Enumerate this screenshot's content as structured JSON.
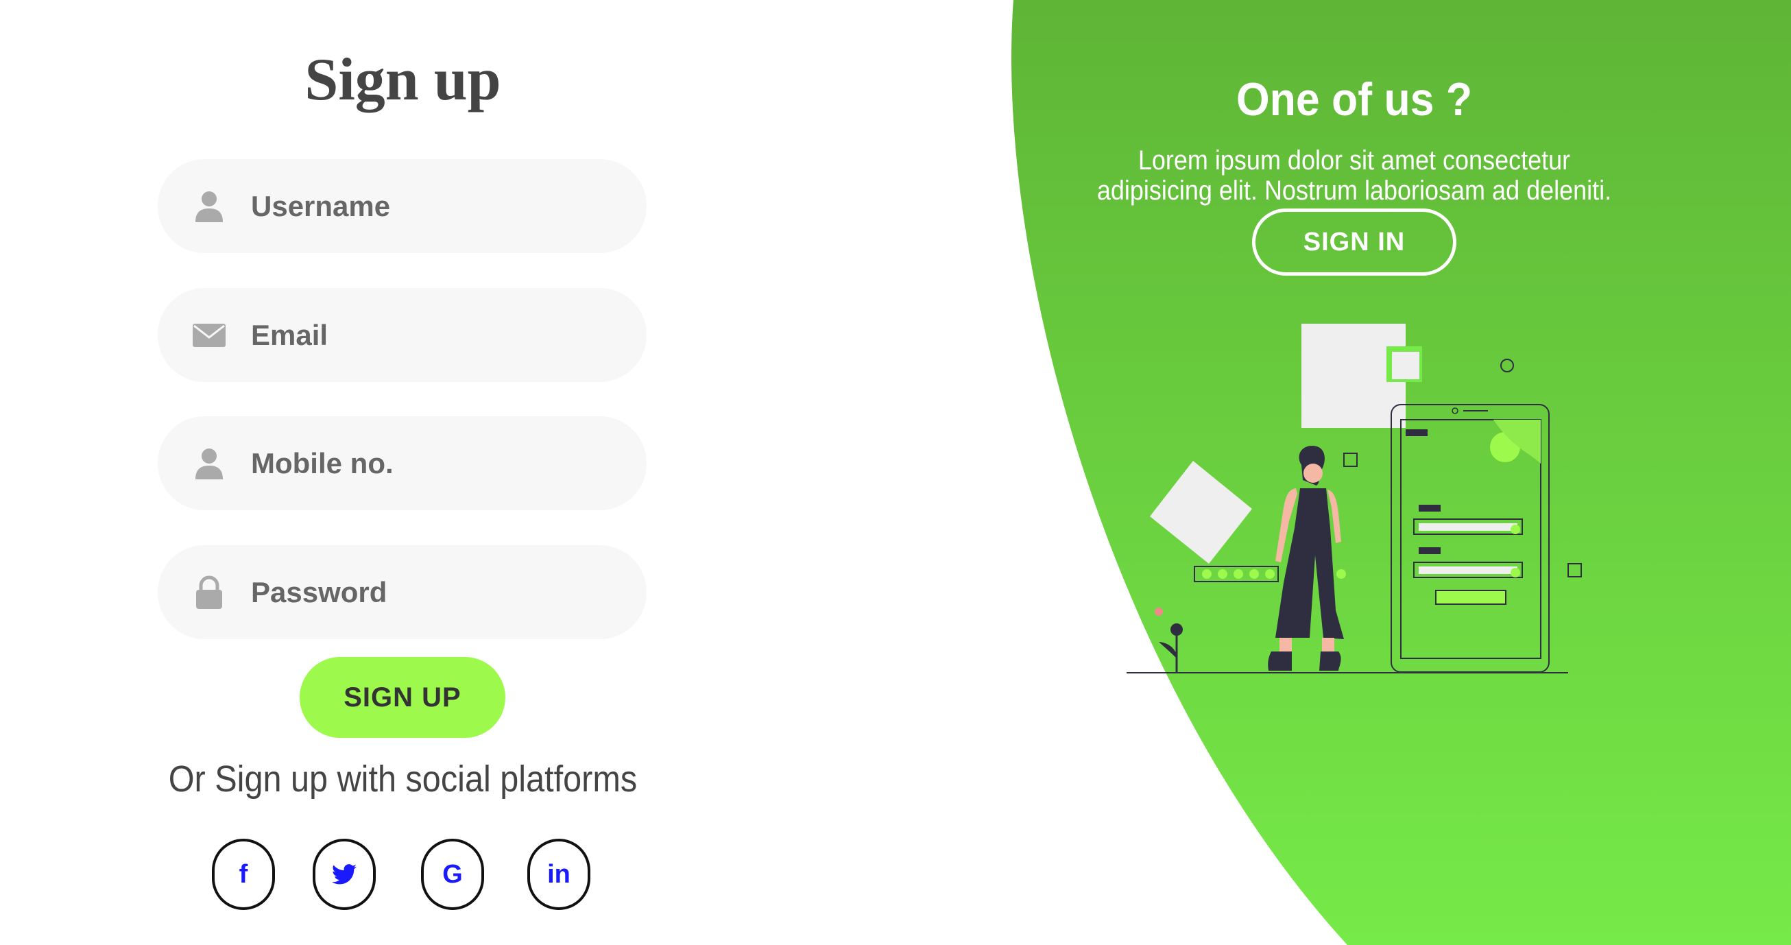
{
  "signup": {
    "title": "Sign up",
    "fields": [
      {
        "icon": "user-icon",
        "placeholder": "Username",
        "value": ""
      },
      {
        "icon": "envelope-icon",
        "placeholder": "Email",
        "value": ""
      },
      {
        "icon": "user-icon",
        "placeholder": "Mobile no.",
        "value": ""
      },
      {
        "icon": "lock-icon",
        "placeholder": "Password",
        "value": ""
      }
    ],
    "submit_label": "SIGN UP",
    "social_text": "Or Sign up with social platforms",
    "social": [
      {
        "name": "facebook",
        "glyph": "f",
        "icon": "facebook-icon"
      },
      {
        "name": "twitter",
        "glyph": "",
        "icon": "twitter-icon"
      },
      {
        "name": "google",
        "glyph": "G",
        "icon": "google-icon"
      },
      {
        "name": "linkedin",
        "glyph": "in",
        "icon": "linkedin-icon"
      }
    ]
  },
  "panel": {
    "title": "One of us ?",
    "text": "Lorem ipsum dolor sit amet consectetur adipisicing elit. Nostrum laboriosam ad deleniti.",
    "button_label": "SIGN IN"
  },
  "colors": {
    "accent": "#9dfa4c",
    "panel_top": "#5fb536",
    "panel_bottom": "#76ea48",
    "field_bg": "#f8f7f8",
    "social_icon": "#1a1aff"
  }
}
